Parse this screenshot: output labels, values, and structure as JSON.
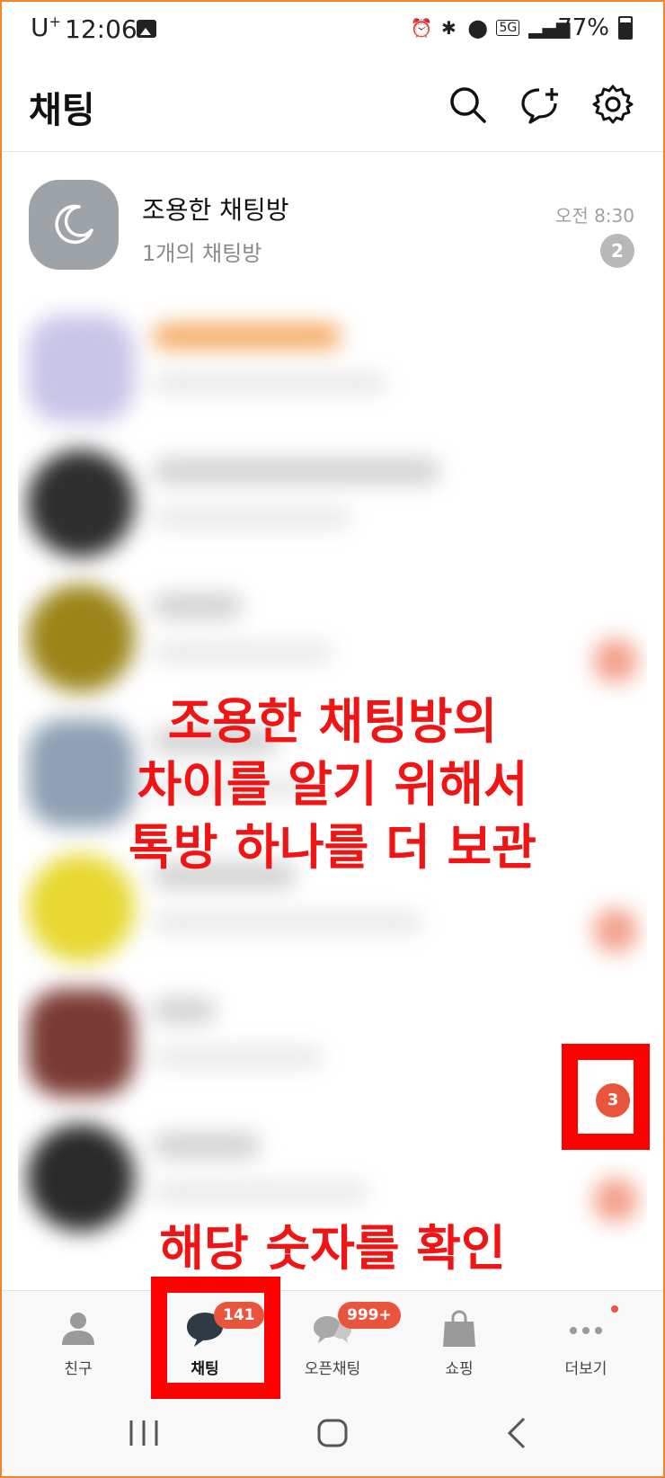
{
  "status_bar": {
    "carrier": "U",
    "carrier_sup": "+",
    "time": "12:06",
    "network": "5G",
    "battery": "77%"
  },
  "header": {
    "title": "채팅"
  },
  "quiet_room": {
    "name": "조용한 채팅방",
    "subtitle": "1개의 채팅방",
    "time": "오전 8:30",
    "badge": "2"
  },
  "annotations": {
    "main_line1": "조용한 채팅방의",
    "main_line2": "차이를 알기 위해서",
    "main_line3": "톡방 하나를 더 보관",
    "bottom": "해당 숫자를 확인"
  },
  "highlighted_count": "3",
  "bottom_nav": {
    "friends": "친구",
    "chats": "채팅",
    "chats_badge": "141",
    "openchat": "오픈채팅",
    "openchat_badge": "999+",
    "shopping": "쇼핑",
    "more": "더보기"
  },
  "colors": {
    "accent_badge": "#e8553c",
    "annotation_red": "#f01414",
    "frame": "#f0872f"
  }
}
